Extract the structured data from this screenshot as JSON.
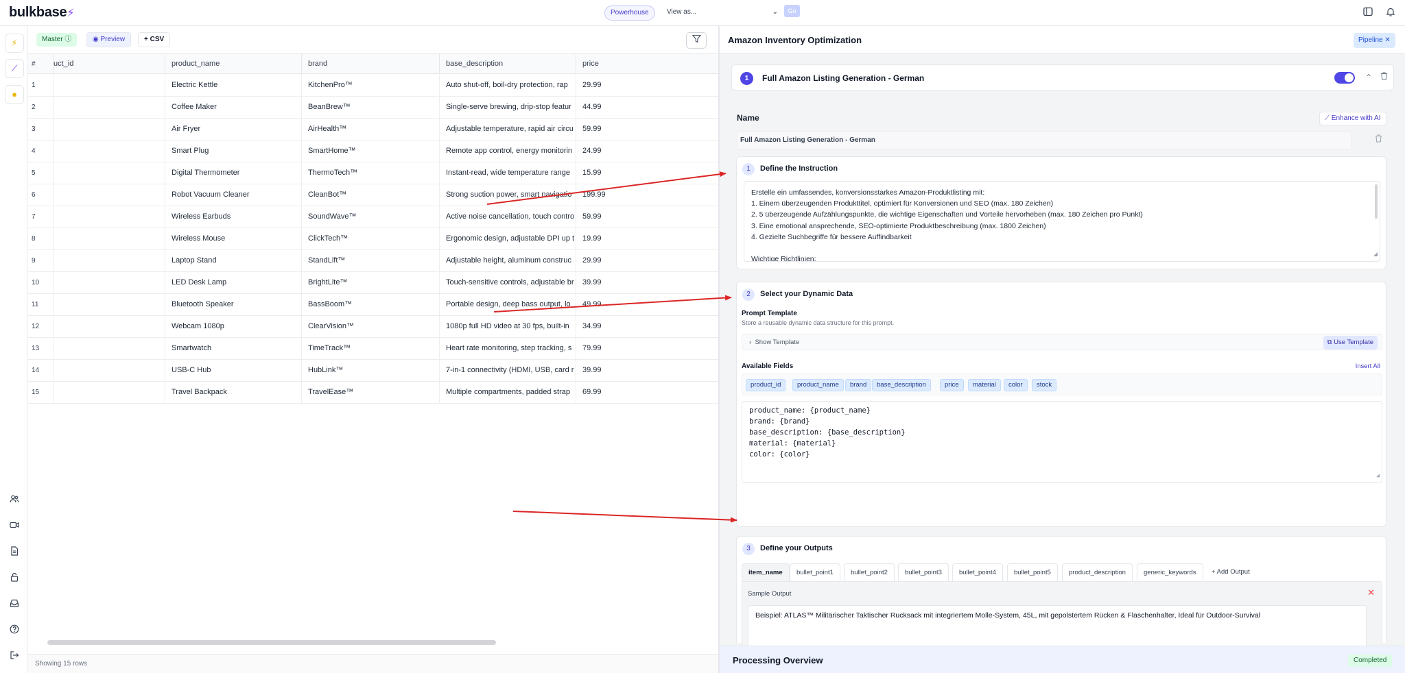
{
  "app": {
    "logo": "bulkbase",
    "workspace": "Powerhouse",
    "view_as": "View as...",
    "go_label": "Go"
  },
  "toolbar": {
    "master_label": "Master",
    "preview_label": "Preview",
    "csv_label": "CSV"
  },
  "table": {
    "headers": [
      "#",
      "uct_id",
      "product_name",
      "brand",
      "base_description",
      "price"
    ],
    "rows": [
      {
        "n": "1",
        "product_name": "Electric Kettle",
        "brand": "KitchenPro™",
        "base_description": "Auto shut-off, boil-dry protection, rap",
        "price": "29.99"
      },
      {
        "n": "2",
        "product_name": "Coffee Maker",
        "brand": "BeanBrew™",
        "base_description": "Single-serve brewing, drip-stop featur",
        "price": "44.99"
      },
      {
        "n": "3",
        "product_name": "Air Fryer",
        "brand": "AirHealth™",
        "base_description": "Adjustable temperature, rapid air circu",
        "price": "59.99"
      },
      {
        "n": "4",
        "product_name": "Smart Plug",
        "brand": "SmartHome™",
        "base_description": "Remote app control, energy monitorin",
        "price": "24.99"
      },
      {
        "n": "5",
        "product_name": "Digital Thermometer",
        "brand": "ThermoTech™",
        "base_description": "Instant-read, wide temperature range",
        "price": "15.99"
      },
      {
        "n": "6",
        "product_name": "Robot Vacuum Cleaner",
        "brand": "CleanBot™",
        "base_description": "Strong suction power, smart navigatio",
        "price": "199.99"
      },
      {
        "n": "7",
        "product_name": "Wireless Earbuds",
        "brand": "SoundWave™",
        "base_description": "Active noise cancellation, touch contro",
        "price": "59.99"
      },
      {
        "n": "8",
        "product_name": "Wireless Mouse",
        "brand": "ClickTech™",
        "base_description": "Ergonomic design, adjustable DPI up t",
        "price": "19.99"
      },
      {
        "n": "9",
        "product_name": "Laptop Stand",
        "brand": "StandLift™",
        "base_description": "Adjustable height, aluminum construc",
        "price": "29.99"
      },
      {
        "n": "10",
        "product_name": "LED Desk Lamp",
        "brand": "BrightLite™",
        "base_description": "Touch-sensitive controls, adjustable br",
        "price": "39.99"
      },
      {
        "n": "11",
        "product_name": "Bluetooth Speaker",
        "brand": "BassBoom™",
        "base_description": "Portable design, deep bass output, lo",
        "price": "49.99"
      },
      {
        "n": "12",
        "product_name": "Webcam 1080p",
        "brand": "ClearVision™",
        "base_description": "1080p full HD video at 30 fps, built-in",
        "price": "34.99"
      },
      {
        "n": "13",
        "product_name": "Smartwatch",
        "brand": "TimeTrack™",
        "base_description": "Heart rate monitoring, step tracking, s",
        "price": "79.99"
      },
      {
        "n": "14",
        "product_name": "USB-C Hub",
        "brand": "HubLink™",
        "base_description": "7-in-1 connectivity (HDMI, USB, card r",
        "price": "39.99"
      },
      {
        "n": "15",
        "product_name": "Travel Backpack",
        "brand": "TravelEase™",
        "base_description": "Multiple compartments, padded strap",
        "price": "69.99"
      }
    ],
    "footer": "Showing 15 rows"
  },
  "panel": {
    "title": "Amazon Inventory Optimization",
    "pipeline_label": "Pipeline",
    "step": {
      "number": "1",
      "title": "Full Amazon Listing Generation - German",
      "enabled": true
    },
    "name_label": "Name",
    "enhance_label": "Enhance with AI",
    "name_value": "Full Amazon Listing Generation - German",
    "instruction": {
      "number": "1",
      "title": "Define the Instruction",
      "lines": [
        "Erstelle ein umfassendes, konversionsstarkes Amazon-Produktlisting mit:",
        "1. Einem überzeugenden Produkttitel, optimiert für Konversionen und SEO (max. 180 Zeichen)",
        "2. 5 überzeugende Aufzählungspunkte, die wichtige Eigenschaften und Vorteile hervorheben (max. 180 Zeichen pro Punkt)",
        "3. Eine emotional ansprechende, SEO-optimierte Produktbeschreibung (max. 1800 Zeichen)",
        "4. Gezielte Suchbegriffe für bessere Auffindbarkeit",
        "",
        "Wichtige Richtlinien:"
      ]
    },
    "dynamic": {
      "number": "2",
      "title": "Select your Dynamic Data",
      "prompt_template_label": "Prompt Template",
      "prompt_template_help": "Store a reusable dynamic data structure for this prompt.",
      "show_template": "Show Template",
      "use_template": "Use Template",
      "available_fields_label": "Available Fields",
      "insert_all": "Insert All",
      "fields": [
        "product_id",
        "product_name",
        "brand",
        "base_description",
        "price",
        "material",
        "color",
        "stock"
      ],
      "template_lines": [
        "product_name: {product_name}",
        "brand: {brand}",
        "base_description: {base_description}",
        "material: {material}",
        "color: {color}"
      ]
    },
    "outputs": {
      "number": "3",
      "title": "Define your Outputs",
      "tabs": [
        "item_name",
        "bullet_point1",
        "bullet_point2",
        "bullet_point3",
        "bullet_point4",
        "bullet_point5",
        "product_description",
        "generic_keywords"
      ],
      "add_label": "+ Add Output",
      "sample_label": "Sample Output",
      "sample_text": "Beispiel: ATLAS™ Militärischer Taktischer Rucksack mit integriertem Molle-System, 45L, mit gepolstertem Rücken & Flaschenhalter, Ideal für Outdoor-Survival"
    },
    "processing": {
      "title": "Processing Overview",
      "status": "Completed"
    }
  },
  "colors": {
    "accent": "#4f46e5",
    "brand_bolt": "#7c3aed",
    "arrow": "#dc2626",
    "success": "#166534"
  },
  "icons": {
    "rail_top": [
      "bolt-icon",
      "wand-icon",
      "lightbulb-icon"
    ],
    "rail_bottom": [
      "users-icon",
      "video-icon",
      "document-icon",
      "lock-icon",
      "inbox-icon",
      "help-icon",
      "logout-icon"
    ]
  }
}
